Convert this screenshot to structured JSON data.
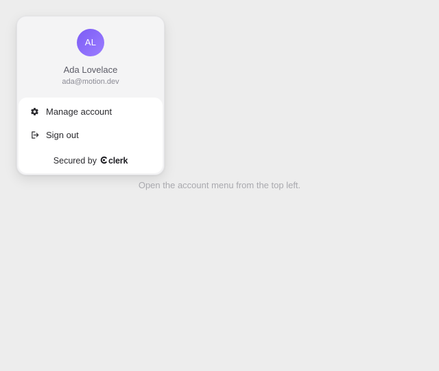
{
  "user_menu": {
    "avatar_initials": "AL",
    "name": "Ada Lovelace",
    "email": "ada@motion.dev",
    "avatar_color": "#8b6cfa",
    "actions": [
      {
        "label": "Manage account",
        "icon": "gear-icon"
      },
      {
        "label": "Sign out",
        "icon": "sign-out-icon"
      }
    ],
    "footer": {
      "secured_by_label": "Secured by",
      "brand": "clerk",
      "brand_icon": "clerk-logo-icon"
    }
  },
  "main": {
    "hint_text": "Open the account menu from the top left."
  }
}
